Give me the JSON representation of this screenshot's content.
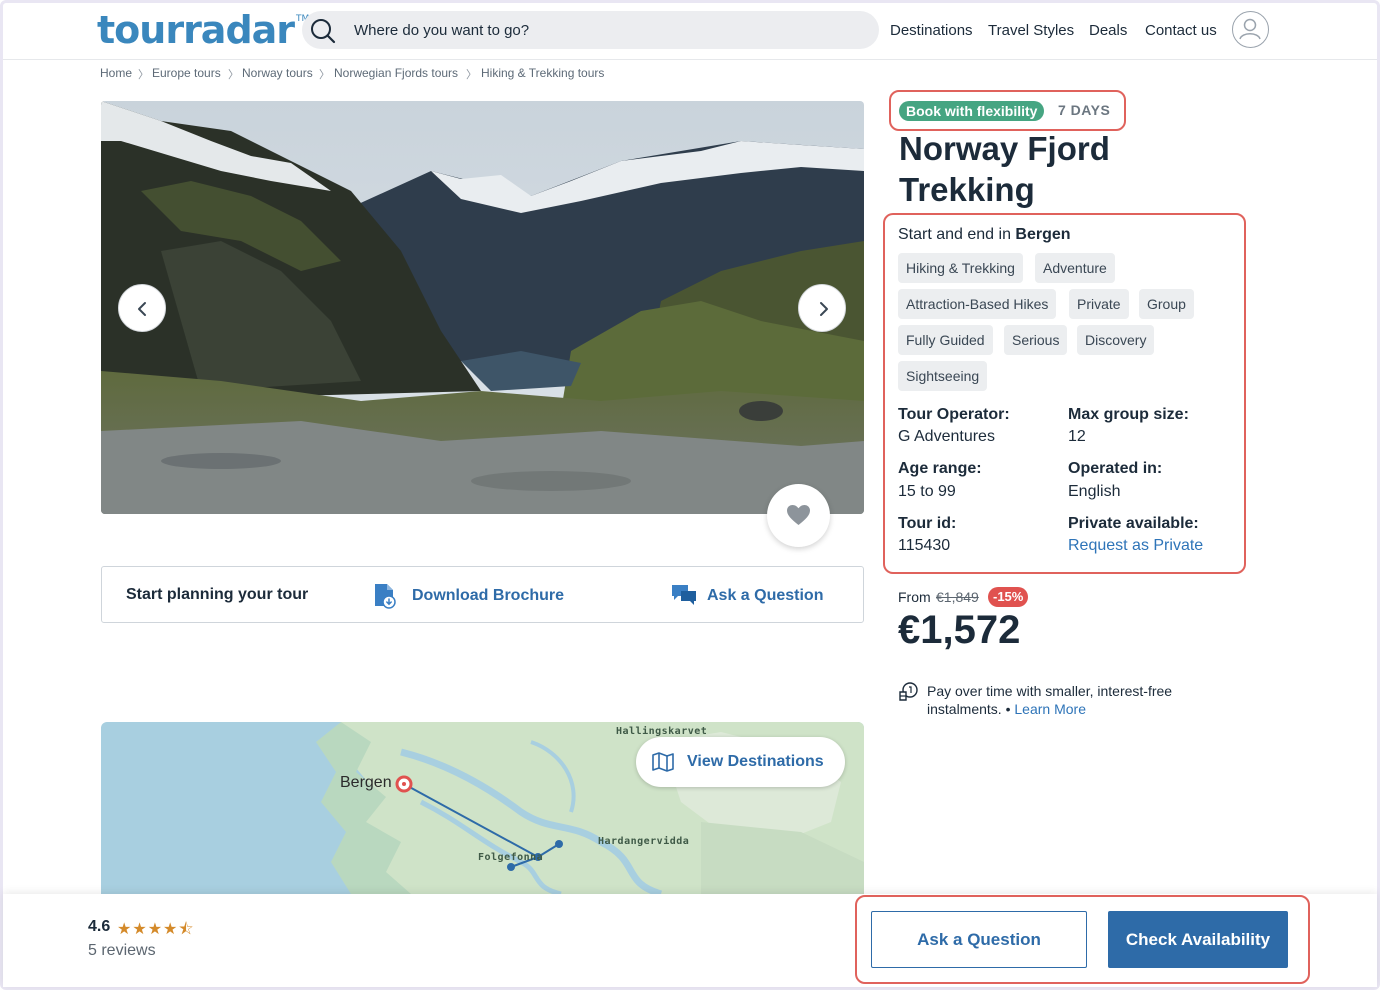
{
  "header": {
    "logo": "tourradar",
    "logo_tm": "TM",
    "search_placeholder": "Where do you want to go?",
    "nav": [
      "Destinations",
      "Travel Styles",
      "Deals",
      "Contact us"
    ]
  },
  "breadcrumb": [
    "Home",
    "Europe tours",
    "Norway tours",
    "Norwegian Fjords tours",
    "Hiking & Trekking tours"
  ],
  "planning": {
    "label": "Start planning your tour",
    "brochure": "Download Brochure",
    "ask": "Ask a Question"
  },
  "map": {
    "button": "View Destinations",
    "start_city": "Bergen",
    "places": [
      "Hallingskarvet",
      "Hardangervidda",
      "Folgefonna"
    ]
  },
  "tour": {
    "badge": "Book with flexibility",
    "duration": "7 DAYS",
    "title": "Norway Fjord Trekking",
    "start_end_prefix": "Start and end in",
    "start_end_city": "Bergen",
    "tags": [
      "Hiking & Trekking",
      "Adventure",
      "Attraction-Based Hikes",
      "Private",
      "Group",
      "Fully Guided",
      "Serious",
      "Discovery",
      "Sightseeing"
    ],
    "operator_label": "Tour Operator:",
    "operator": "G Adventures",
    "group_label": "Max group size:",
    "group": "12",
    "age_label": "Age range:",
    "age": "15 to 99",
    "language_label": "Operated in:",
    "language": "English",
    "id_label": "Tour id:",
    "id": "115430",
    "private_label": "Private available:",
    "private_link": "Request as Private"
  },
  "pricing": {
    "from": "From",
    "old_price": "€1,849",
    "discount": "-15%",
    "price": "€1,572",
    "installments": "Pay over time with smaller, interest-free instalments. •",
    "learn_more": "Learn More"
  },
  "footer": {
    "rating": "4.6",
    "stars": "★★★★⯪",
    "reviews": "5 reviews",
    "ask_button": "Ask a Question",
    "check_button": "Check Availability"
  },
  "colors": {
    "brand": "#3a87bd",
    "link": "#2e6ba8",
    "badge_green": "#46a582",
    "discount_red": "#e0524f",
    "highlight_outline": "#e0625c"
  }
}
